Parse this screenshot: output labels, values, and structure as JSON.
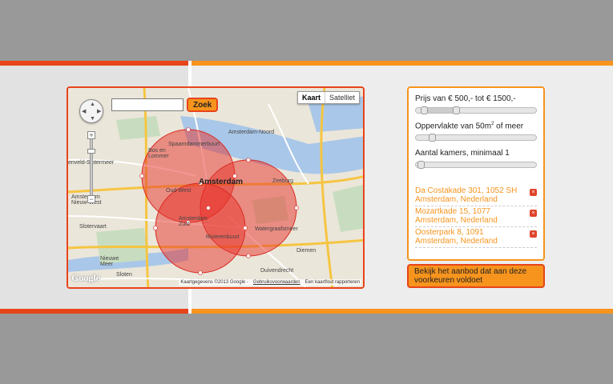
{
  "map": {
    "type_buttons": [
      "Kaart",
      "Satelliet"
    ],
    "search": {
      "value": "",
      "button_label": "Zoek"
    },
    "zoom_in": "+",
    "zoom_out": "−",
    "logo": "Google",
    "credits": "Kaartgegevens ©2013 Google -",
    "terms_link": "Gebruiksvoorwaarden",
    "report_link": "Een kaartfout rapporteren",
    "labels": {
      "spaarndammerbuurt": "Spaarndammerbuurt",
      "bos_en_lommer": "Bos en\nLommer",
      "amsterdam": "Amsterdam",
      "amsterdam_noord": "Amsterdam-Noord",
      "oud_west": "Oud-West",
      "zeeburg": "Zeeburg",
      "amsterdam_west": "Amsterdam\nNieuw-West",
      "slotervaart": "Slotervaart",
      "amsterdam_zuid": "Amsterdam\nZuid",
      "rivierenbuurt": "Rivierenbuurt",
      "watergraafsmeer": "Watergraafsmeer",
      "diemen": "Diemen",
      "duivendrecht": "Duivendrecht",
      "osdorp": "enveld-Slotermeer",
      "sloten": "Sloten",
      "nieuw_vennep": "Nieuwe\nMeer"
    },
    "colors": {
      "circle_fill": "#e8322a",
      "border": "#e8441a"
    }
  },
  "filters": {
    "price_label": "Prijs van € 500,- tot € 1500,-",
    "price_range": [
      500,
      1500
    ],
    "area_label_pre": "Oppervlakte van 50m",
    "area_label_sup": "2",
    "area_label_post": " of meer",
    "area_min": 50,
    "rooms_label": "Aantal kamers, minimaal 1",
    "rooms_min": 1
  },
  "addresses": [
    {
      "text": "Da Costakade 301, 1052 SH Amsterdam, Nederland",
      "delete_icon": "×"
    },
    {
      "text": "Mozartkade 15, 1077 Amsterdam, Nederland",
      "delete_icon": "×"
    },
    {
      "text": "Oosterpark 8, 1091 Amsterdam, Nederland",
      "delete_icon": "×"
    }
  ],
  "cta_label": "Bekijk het aanbod dat aan deze voorkeuren voldoet",
  "colors": {
    "accent_orange": "#f7941d",
    "accent_red": "#e8441a"
  }
}
